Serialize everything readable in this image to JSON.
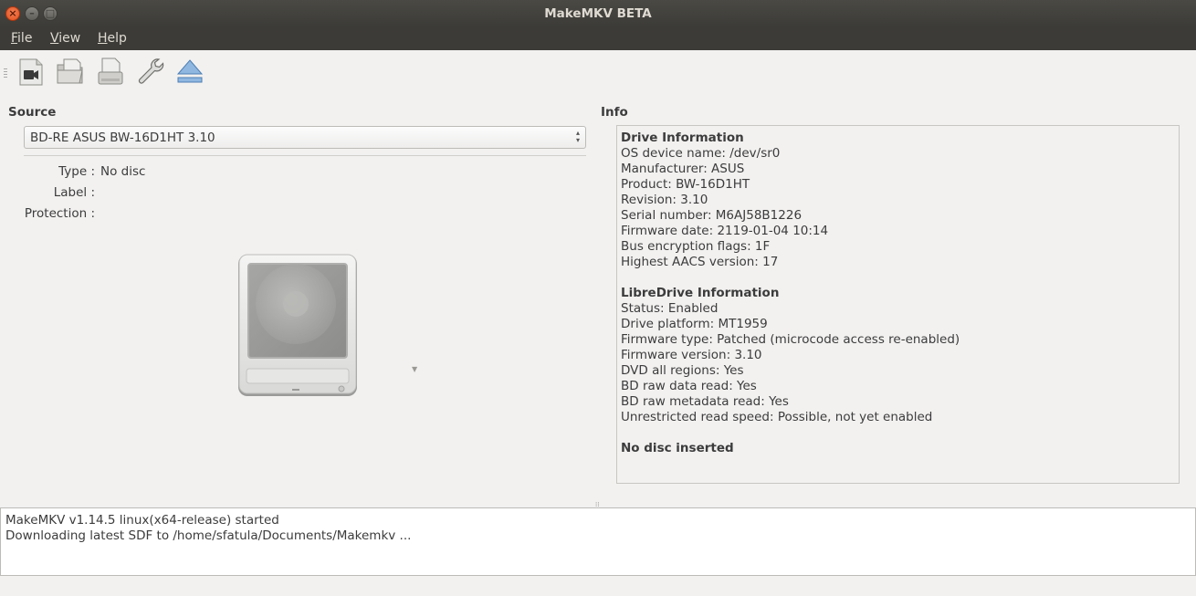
{
  "window": {
    "title": "MakeMKV BETA"
  },
  "menu": [
    {
      "label": "File"
    },
    {
      "label": "View"
    },
    {
      "label": "Help"
    }
  ],
  "toolbar": {
    "buttons": [
      {
        "icon": "video-disc-icon"
      },
      {
        "icon": "open-folder-icon"
      },
      {
        "icon": "open-files-icon"
      },
      {
        "icon": "wrench-icon"
      },
      {
        "icon": "eject-icon"
      }
    ]
  },
  "source": {
    "heading": "Source",
    "drive_selected": "BD-RE ASUS BW-16D1HT 3.10",
    "type_label": "Type :",
    "type_value": "No disc",
    "label_label": "Label :",
    "label_value": "",
    "protection_label": "Protection :",
    "protection_value": ""
  },
  "info": {
    "heading": "Info",
    "drive_heading": "Drive Information",
    "drive_lines": [
      "OS device name: /dev/sr0",
      "Manufacturer: ASUS",
      "Product: BW-16D1HT",
      "Revision: 3.10",
      "Serial number: M6AJ58B1226",
      "Firmware date: 2119-01-04 10:14",
      "Bus encryption flags: 1F",
      "Highest AACS version: 17"
    ],
    "libredrive_heading": "LibreDrive Information",
    "libredrive_lines": [
      "Status: Enabled",
      "Drive platform: MT1959",
      "Firmware type: Patched (microcode access re-enabled)",
      "Firmware version: 3.10",
      "DVD all regions: Yes",
      "BD raw data read: Yes",
      "BD raw metadata read: Yes",
      "Unrestricted read speed: Possible, not yet enabled"
    ],
    "footer": "No disc inserted"
  },
  "log": [
    "MakeMKV v1.14.5 linux(x64-release) started",
    "Downloading latest SDF to /home/sfatula/Documents/Makemkv ..."
  ],
  "colors": {
    "titlebar": "#3c3b37",
    "background": "#f2f1f0",
    "close_button": "#e2501e"
  }
}
